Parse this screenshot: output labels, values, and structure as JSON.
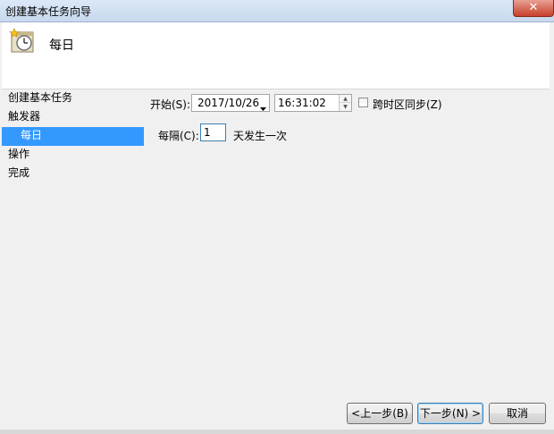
{
  "window": {
    "title": "创建基本任务向导",
    "close_glyph": "✕"
  },
  "header": {
    "icon": "scheduled-task-clock-icon",
    "heading": "每日"
  },
  "nav": {
    "items": [
      {
        "label": "创建基本任务",
        "active": false
      },
      {
        "label": "触发器",
        "active": false
      },
      {
        "label": "每日",
        "active": true
      },
      {
        "label": "操作",
        "active": false
      },
      {
        "label": "完成",
        "active": false
      }
    ]
  },
  "form": {
    "start_label": "开始(S):",
    "start_date": "2017/10/26",
    "start_time": "16:31:02",
    "sync_timezone_label": "跨时区同步(Z)",
    "sync_timezone_checked": false,
    "recur_label": "每隔(C):",
    "recur_value": "1",
    "recur_suffix": "天发生一次"
  },
  "buttons": {
    "back": "<上一步(B)",
    "next": "下一步(N) >",
    "cancel": "取消"
  },
  "colors": {
    "selection": "#3399ff",
    "header_bg": "#ffffff",
    "dialog_bg": "#f0f0f0"
  }
}
